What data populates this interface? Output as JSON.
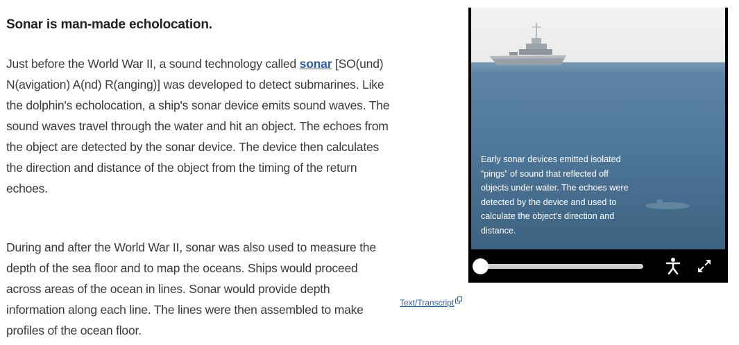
{
  "content": {
    "heading": "Sonar is man-made echolocation.",
    "p1_before_link": "Just before the World War II, a sound technology called ",
    "p1_link": "sonar",
    "p1_after_link": " [SO(und) N(avigation) A(nd) R(anging)] was developed to detect submarines. Like the dolphin's echolocation, a ship's sonar device emits sound waves. The sound waves travel through the water and hit an object. The echoes from the object are detected by the sonar device. The device then calculates the direction and distance of the object from the timing of the return echoes.",
    "p2": "During and after the World War II, sonar was also used to measure the depth of the sea floor and to map the oceans. Ships would proceed across areas of the ocean in lines. Sonar would provide depth information along each line. The lines were then assembled to make profiles of the ocean floor."
  },
  "transcript_link": "Text/Transcript",
  "video": {
    "caption": "Early sonar devices emitted isolated “pings” of sound that reflected off objects under water. The echoes were detected by the device and used to calculate the object’s direction and distance.",
    "progress_fraction": 0.0,
    "icons": [
      "play-progress-knob",
      "accessibility-icon",
      "fullscreen-icon"
    ]
  },
  "colors": {
    "link": "#2a5fa8",
    "player_bg": "#000000",
    "water": "#4f7799"
  }
}
